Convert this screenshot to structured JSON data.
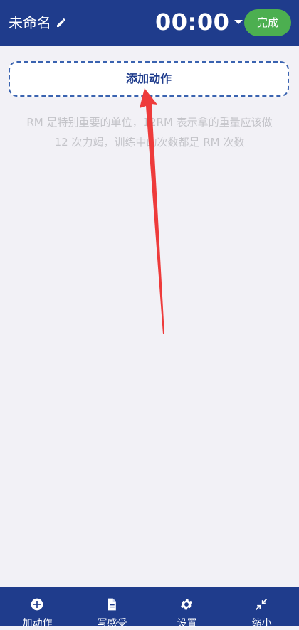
{
  "header": {
    "title": "未命名",
    "timer": "00:00",
    "done_label": "完成"
  },
  "main": {
    "add_action_label": "添加动作",
    "hint_line1": "RM 是特别重要的单位，12RM 表示拿的重量应该做",
    "hint_line2": "12 次力竭，训练中的次数都是 RM 次数"
  },
  "bottom_bar": {
    "tabs": [
      {
        "label": "加动作",
        "icon": "add-circle-icon"
      },
      {
        "label": "写感受",
        "icon": "document-icon"
      },
      {
        "label": "设置",
        "icon": "gear-icon"
      },
      {
        "label": "缩小",
        "icon": "minimize-icon"
      }
    ]
  },
  "colors": {
    "header_bg": "#1f3c8c",
    "done_bg": "#4caf50",
    "page_bg": "#f2f1f6",
    "annotation_arrow": "#ee3b3b"
  }
}
